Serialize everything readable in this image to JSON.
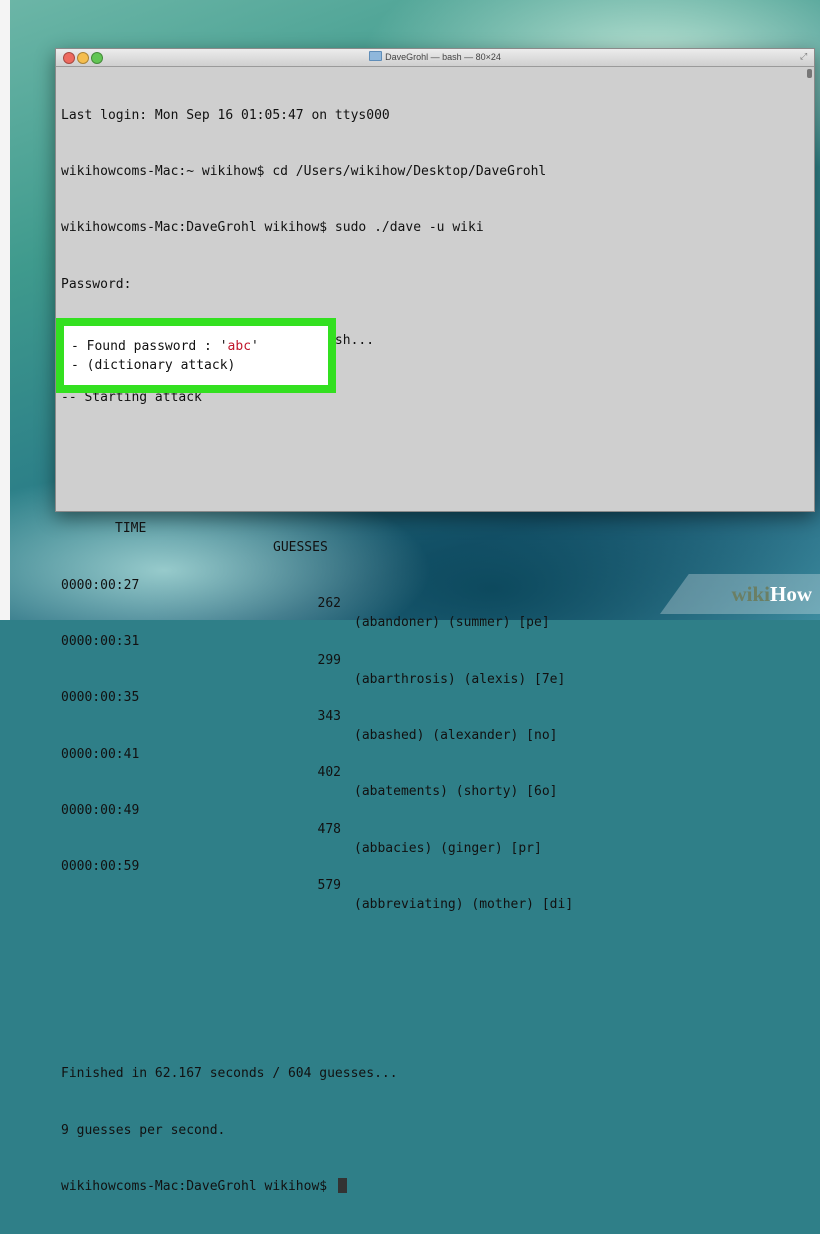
{
  "window": {
    "title": "DaveGrohl — bash — 80×24"
  },
  "terminal": {
    "lines": [
      "Last login: Mon Sep 16 01:05:47 on ttys000",
      "wikihowcoms-Mac:~ wikihow$ cd /Users/wikihow/Desktop/DaveGrohl",
      "wikihowcoms-Mac:DaveGrohl wikihow$ sudo ./dave -u wiki",
      "Password:",
      "-- Loaded PBKDF2 (Salted SHA512) hash...",
      "-- Starting attack"
    ],
    "header": {
      "time": "TIME",
      "guesses": "GUESSES"
    },
    "rows": [
      {
        "time": "0000:00:27",
        "guesses": "262",
        "info": "(abandoner) (summer) [pe]"
      },
      {
        "time": "0000:00:31",
        "guesses": "299",
        "info": "(abarthrosis) (alexis) [7e]"
      },
      {
        "time": "0000:00:35",
        "guesses": "343",
        "info": "(abashed) (alexander) [no]"
      },
      {
        "time": "0000:00:41",
        "guesses": "402",
        "info": "(abatements) (shorty) [6o]"
      },
      {
        "time": "0000:00:49",
        "guesses": "478",
        "info": "(abbacies) (ginger) [pr]"
      },
      {
        "time": "0000:00:59",
        "guesses": "579",
        "info": "(abbreviating) (mother) [di]"
      }
    ],
    "found": {
      "prefix": "- Found password : '",
      "password": "abc",
      "suffix": "'",
      "method": "- (dictionary attack)"
    },
    "footer": [
      "Finished in 62.167 seconds / 604 guesses...",
      "9 guesses per second."
    ],
    "prompt": "wikihowcoms-Mac:DaveGrohl wikihow$ "
  },
  "watermark": {
    "part1": "wiki",
    "part2": "How"
  }
}
